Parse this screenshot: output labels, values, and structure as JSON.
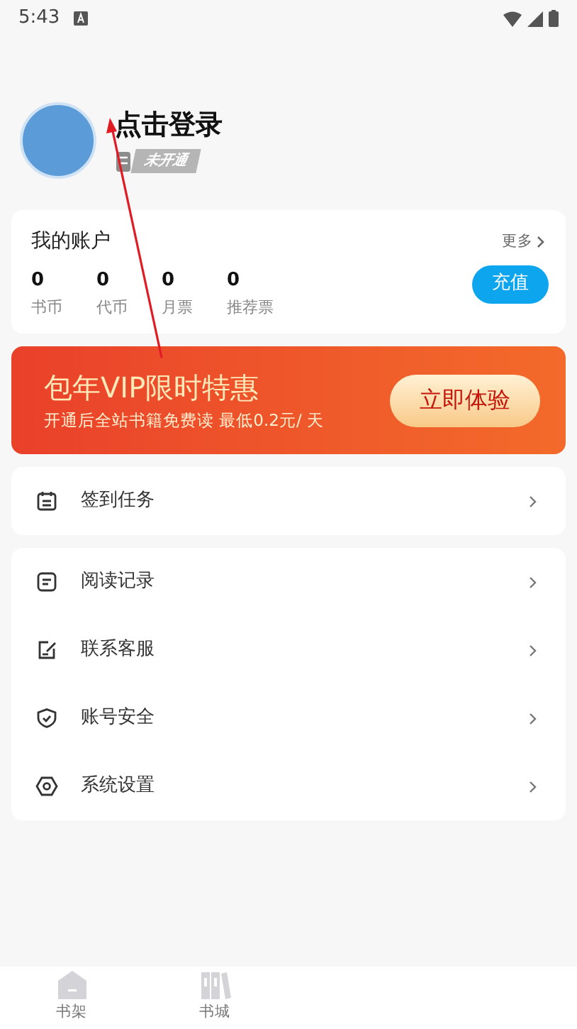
{
  "status_bar": {
    "time": "5:43"
  },
  "profile": {
    "login_label": "点击登录",
    "vip_badge": "未开通"
  },
  "account": {
    "title": "我的账户",
    "more": "更多",
    "recharge_button": "充值",
    "stats": [
      {
        "value": "0",
        "label": "书币"
      },
      {
        "value": "0",
        "label": "代币"
      },
      {
        "value": "0",
        "label": "月票"
      },
      {
        "value": "0",
        "label": "推荐票"
      }
    ]
  },
  "vip_banner": {
    "title": "包年VIP限时特惠",
    "subtitle": "开通后全站书籍免费读 最低0.2元/ 天",
    "button": "立即体验"
  },
  "menu_groups": [
    [
      {
        "kind": "checkin",
        "label": "签到任务"
      }
    ],
    [
      {
        "kind": "history",
        "label": "阅读记录"
      },
      {
        "kind": "service",
        "label": "联系客服"
      },
      {
        "kind": "security",
        "label": "账号安全"
      },
      {
        "kind": "settings",
        "label": "系统设置"
      }
    ]
  ],
  "bottom_nav": [
    {
      "kind": "shelf",
      "label": "书架",
      "selected": false
    },
    {
      "kind": "store",
      "label": "书城",
      "selected": false
    }
  ]
}
